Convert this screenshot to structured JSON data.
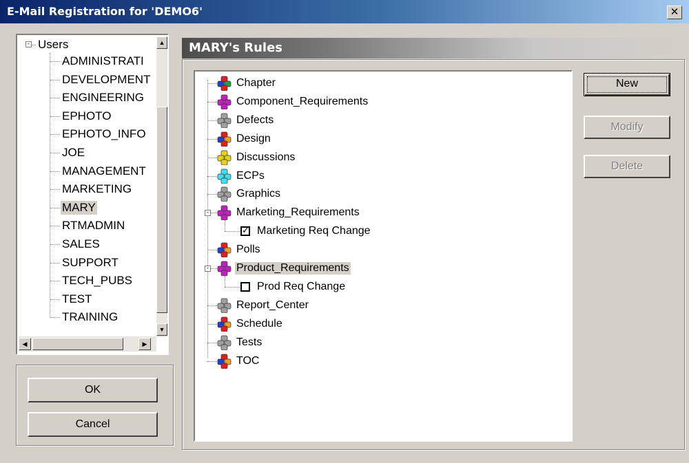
{
  "window": {
    "title": "E-Mail Registration for 'DEMO6'",
    "close_label": "✕"
  },
  "users": {
    "root_label": "Users",
    "items": [
      "ADMINISTRATI",
      "DEVELOPMENT",
      "ENGINEERING",
      "EPHOTO",
      "EPHOTO_INFO",
      "JOE",
      "MANAGEMENT",
      "MARKETING",
      "MARY",
      "RTMADMIN",
      "SALES",
      "SUPPORT",
      "TECH_PUBS",
      "TEST",
      "TRAINING"
    ],
    "selected": "MARY"
  },
  "buttons": {
    "ok": "OK",
    "cancel": "Cancel",
    "new": "New",
    "modify": "Modify",
    "delete": "Delete"
  },
  "rules": {
    "header": "MARY's Rules",
    "items": [
      {
        "label": "Chapter",
        "icon": "cube-cluster-red-icon",
        "colors": [
          "#e02020",
          "#2040d0",
          "#20a040"
        ]
      },
      {
        "label": "Component_Requirements",
        "icon": "cube-cluster-purple-icon",
        "colors": [
          "#c020c0",
          "#c020c0",
          "#c020c0"
        ]
      },
      {
        "label": "Defects",
        "icon": "cube-cluster-gray-icon",
        "colors": [
          "#a0a0a0",
          "#a0a0a0",
          "#a0a0a0"
        ]
      },
      {
        "label": "Design",
        "icon": "cube-cluster-red-blue-icon",
        "colors": [
          "#e02020",
          "#2040d0",
          "#f0a020"
        ]
      },
      {
        "label": "Discussions",
        "icon": "cube-cluster-yellow-icon",
        "colors": [
          "#e8d020",
          "#e8d020",
          "#e8d020"
        ]
      },
      {
        "label": "ECPs",
        "icon": "cube-cluster-cyan-icon",
        "colors": [
          "#40e0f0",
          "#40e0f0",
          "#40e0f0"
        ]
      },
      {
        "label": "Graphics",
        "icon": "cube-cluster-gray-icon",
        "colors": [
          "#a0a0a0",
          "#a0a0a0",
          "#a0a0a0"
        ]
      },
      {
        "label": "Marketing_Requirements",
        "icon": "cube-cluster-purple-icon",
        "colors": [
          "#c020c0",
          "#c020c0",
          "#c020c0"
        ],
        "expanded": true,
        "child": {
          "label": "Marketing Req Change",
          "checked": true
        }
      },
      {
        "label": "Polls",
        "icon": "cube-cluster-red-blue-icon",
        "colors": [
          "#e02020",
          "#2040d0",
          "#f0a020"
        ]
      },
      {
        "label": "Product_Requirements",
        "icon": "cube-cluster-purple-icon",
        "colors": [
          "#c020c0",
          "#c020c0",
          "#c020c0"
        ],
        "expanded": true,
        "selected": true,
        "child": {
          "label": "Prod Req Change",
          "checked": false
        }
      },
      {
        "label": "Report_Center",
        "icon": "cube-cluster-gray-icon",
        "colors": [
          "#a0a0a0",
          "#a0a0a0",
          "#a0a0a0"
        ]
      },
      {
        "label": "Schedule",
        "icon": "cube-cluster-red-blue-icon",
        "colors": [
          "#e02020",
          "#2040d0",
          "#f0a020"
        ]
      },
      {
        "label": "Tests",
        "icon": "cube-cluster-gray-icon",
        "colors": [
          "#a0a0a0",
          "#a0a0a0",
          "#a0a0a0"
        ]
      },
      {
        "label": "TOC",
        "icon": "cube-cluster-red-blue-icon",
        "colors": [
          "#e02020",
          "#2040d0",
          "#f0a020"
        ]
      }
    ],
    "check_mark": "✓"
  }
}
